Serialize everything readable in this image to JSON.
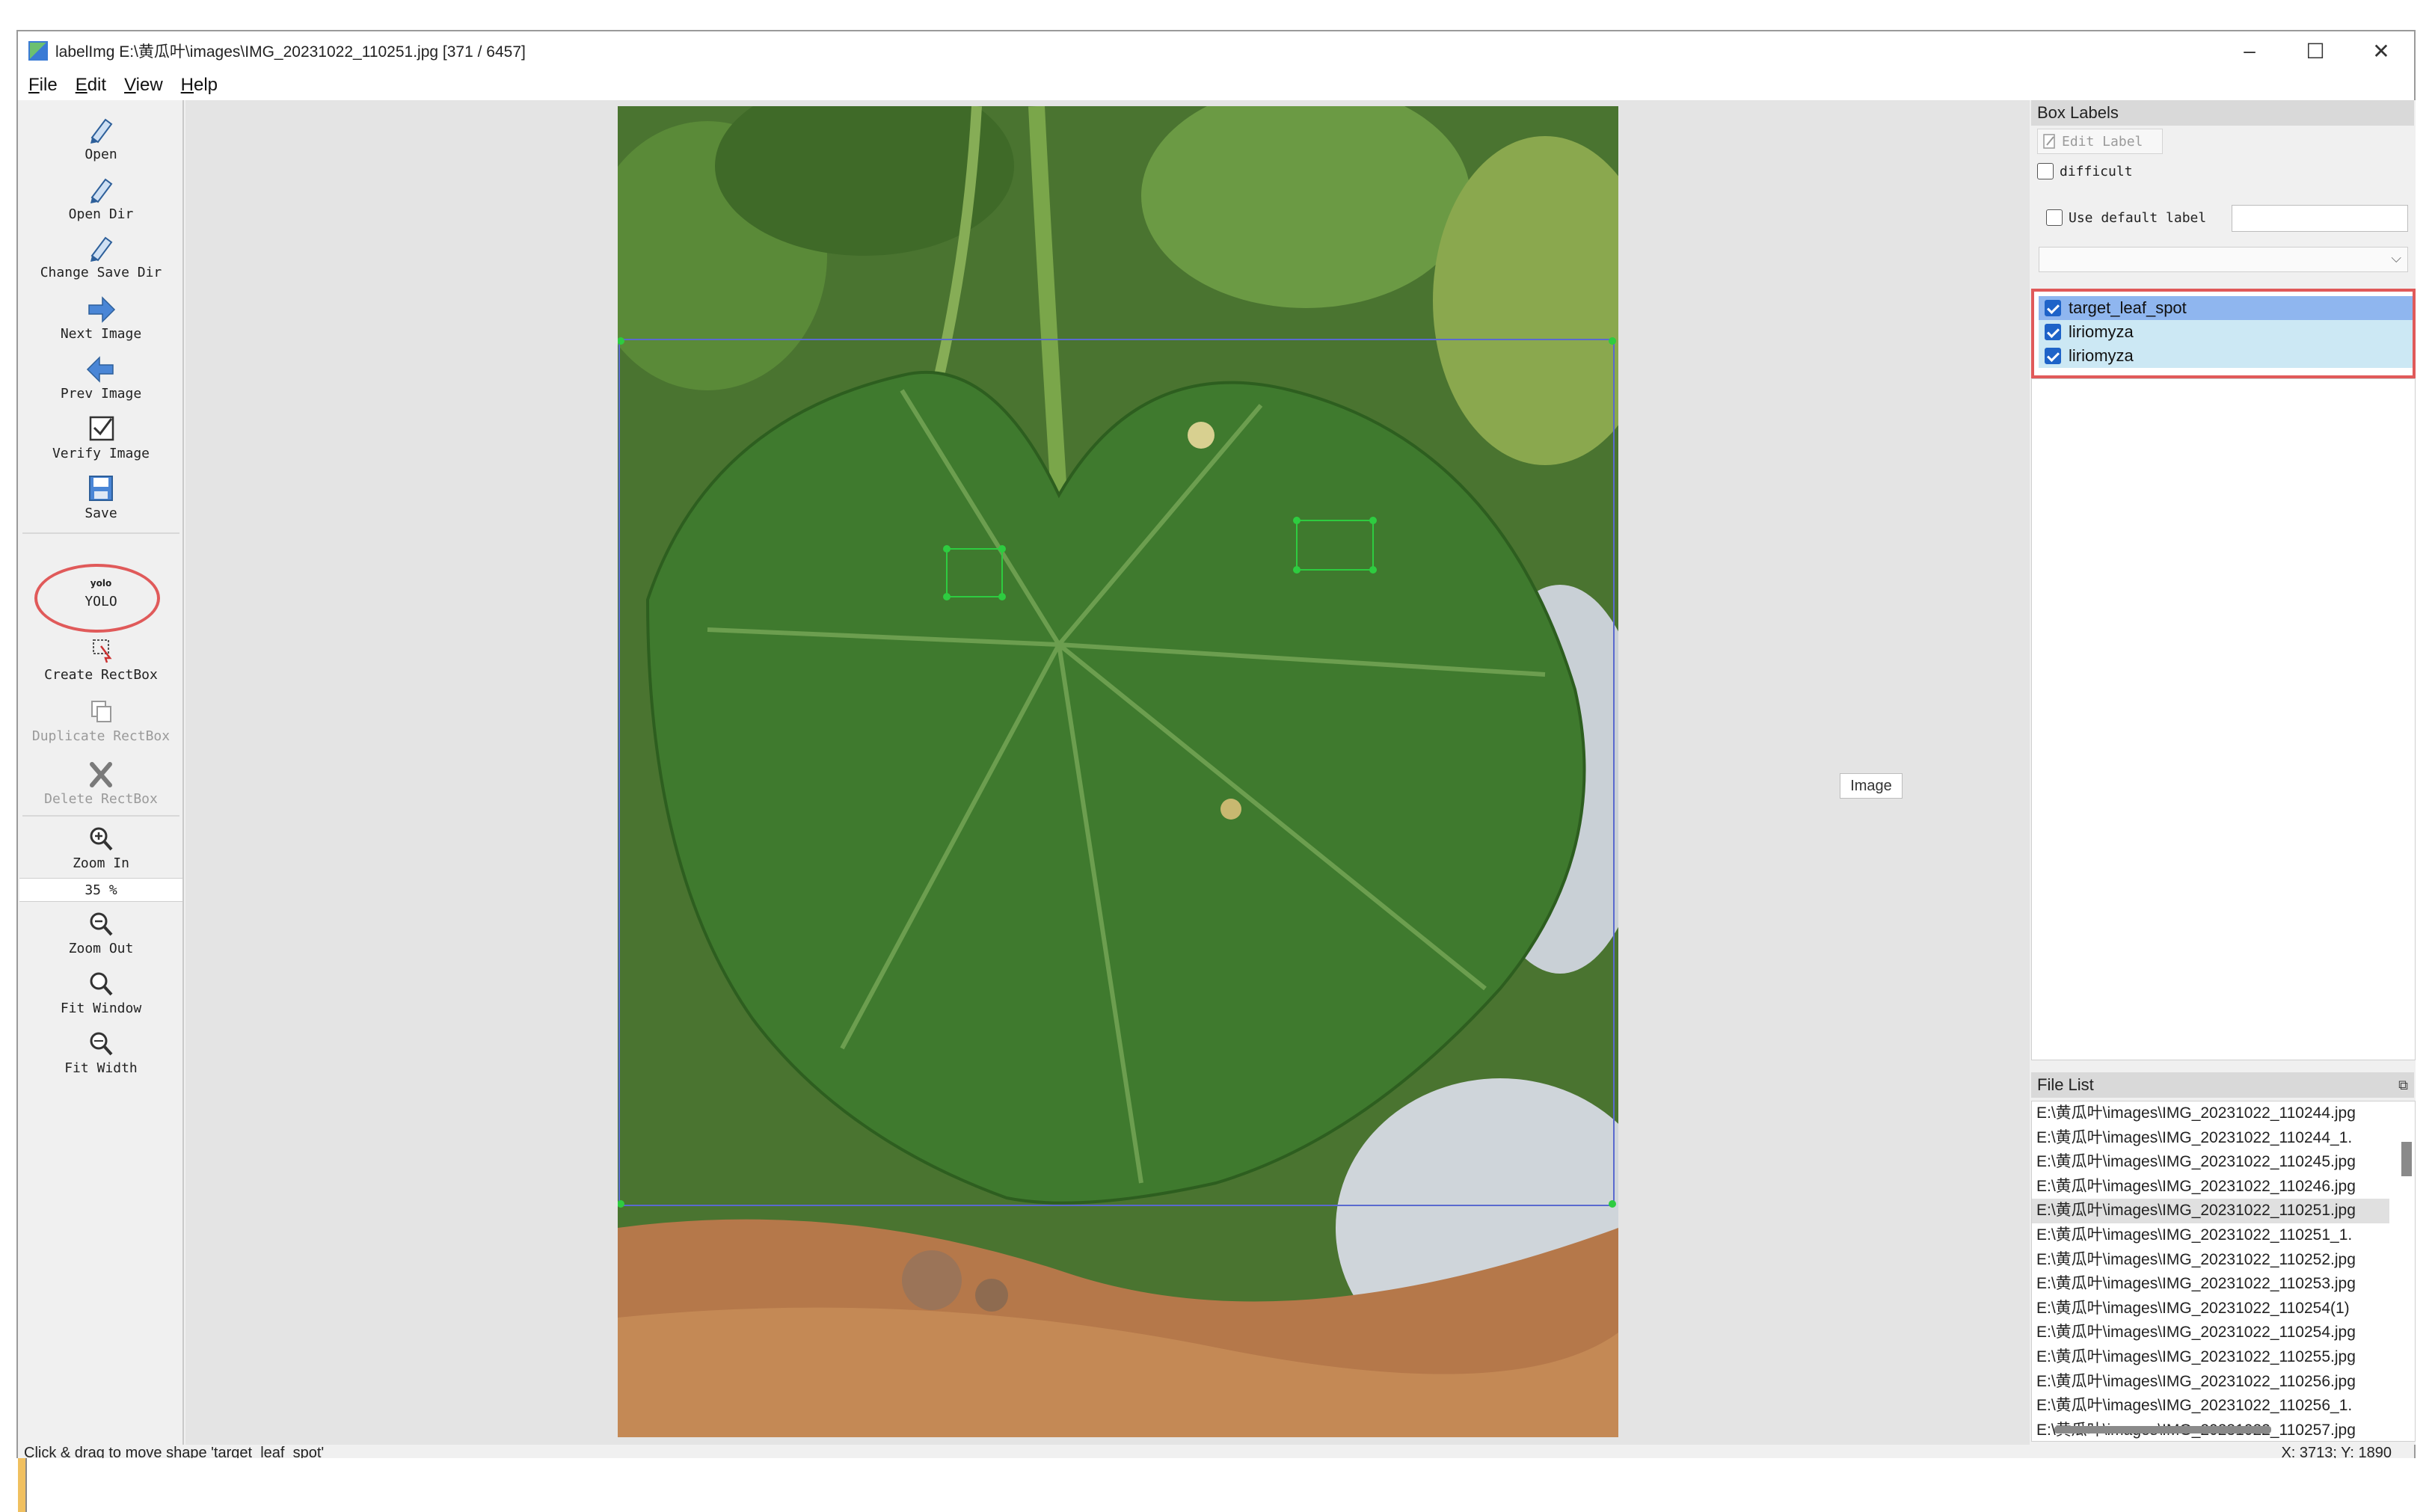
{
  "window": {
    "title": "labelImg E:\\黄瓜叶\\images\\IMG_20231022_110251.jpg [371 / 6457]",
    "controls": {
      "minimize": "–",
      "maximize": "☐",
      "close": "✕"
    }
  },
  "menu": {
    "items": [
      "File",
      "Edit",
      "View",
      "Help"
    ]
  },
  "toolbar": {
    "open": "Open",
    "open_dir": "Open Dir",
    "change_save_dir": "Change Save Dir",
    "next_image": "Next Image",
    "prev_image": "Prev Image",
    "verify_image": "Verify Image",
    "save": "Save",
    "yolo_icon": "yolo",
    "yolo": "YOLO",
    "create_rectbox": "Create RectBox",
    "duplicate_rectbox": "Duplicate RectBox",
    "delete_rectbox": "Delete RectBox",
    "zoom_in": "Zoom In",
    "zoom_value": "35 %",
    "zoom_out": "Zoom Out",
    "fit_window": "Fit Window",
    "fit_width": "Fit Width"
  },
  "canvas": {
    "image_tag": "Image"
  },
  "box_labels": {
    "title": "Box Labels",
    "edit_label": "Edit Label",
    "difficult": "difficult",
    "use_default_label": "Use default label",
    "labels": [
      {
        "name": "target_leaf_spot",
        "checked": true,
        "selected": true
      },
      {
        "name": "liriomyza",
        "checked": true,
        "selected": false
      },
      {
        "name": "liriomyza",
        "checked": true,
        "selected": false
      }
    ]
  },
  "file_list": {
    "title": "File List",
    "files": [
      "E:\\黄瓜叶\\images\\IMG_20231022_110244.jpg",
      "E:\\黄瓜叶\\images\\IMG_20231022_110244_1.",
      "E:\\黄瓜叶\\images\\IMG_20231022_110245.jpg",
      "E:\\黄瓜叶\\images\\IMG_20231022_110246.jpg",
      "E:\\黄瓜叶\\images\\IMG_20231022_110251.jpg",
      "E:\\黄瓜叶\\images\\IMG_20231022_110251_1.",
      "E:\\黄瓜叶\\images\\IMG_20231022_110252.jpg",
      "E:\\黄瓜叶\\images\\IMG_20231022_110253.jpg",
      "E:\\黄瓜叶\\images\\IMG_20231022_110254(1)",
      "E:\\黄瓜叶\\images\\IMG_20231022_110254.jpg",
      "E:\\黄瓜叶\\images\\IMG_20231022_110255.jpg",
      "E:\\黄瓜叶\\images\\IMG_20231022_110256.jpg",
      "E:\\黄瓜叶\\images\\IMG_20231022_110256_1.",
      "E:\\黄瓜叶\\images\\IMG_20231022_110257.jpg"
    ],
    "current_index": 4
  },
  "status": {
    "message": "Click & drag to move shape 'target_leaf_spot'",
    "coords": "X: 3713; Y: 1890"
  },
  "colors": {
    "annotation_highlight": "#e05a5a",
    "box_handle": "#2ecc40",
    "selected_label_bg": "#8fb6ef",
    "label_bg": "#cce8f4"
  }
}
